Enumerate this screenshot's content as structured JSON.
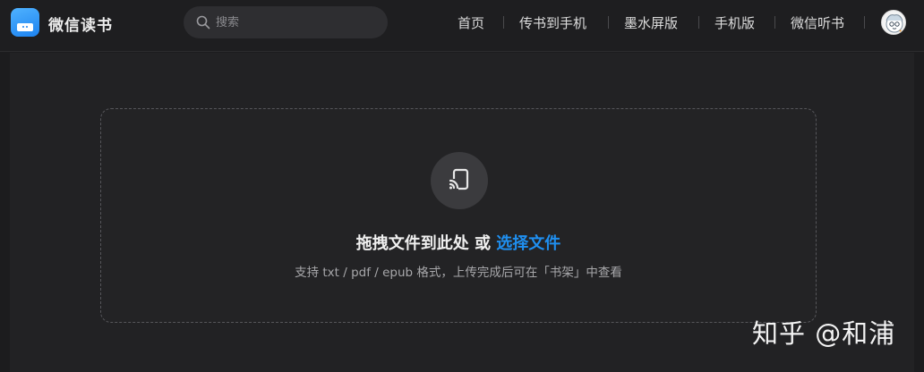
{
  "header": {
    "app_name": "微信读书",
    "search": {
      "placeholder": "搜索",
      "value": ""
    },
    "nav": [
      {
        "label": "首页"
      },
      {
        "label": "传书到手机"
      },
      {
        "label": "墨水屏版"
      },
      {
        "label": "手机版"
      },
      {
        "label": "微信听书"
      }
    ]
  },
  "upload": {
    "headline": "拖拽文件到此处 或 ",
    "link": "选择文件",
    "subtext": "支持 txt / pdf / epub 格式，上传完成后可在「书架」中查看"
  },
  "watermark": "知乎 @和浦",
  "colors": {
    "accent": "#1f8ff0",
    "background": "#1c1c1e",
    "logo": "#2a90f5"
  },
  "icons": [
    "search-icon",
    "cast-to-device-icon",
    "app-logo-icon",
    "user-avatar"
  ]
}
